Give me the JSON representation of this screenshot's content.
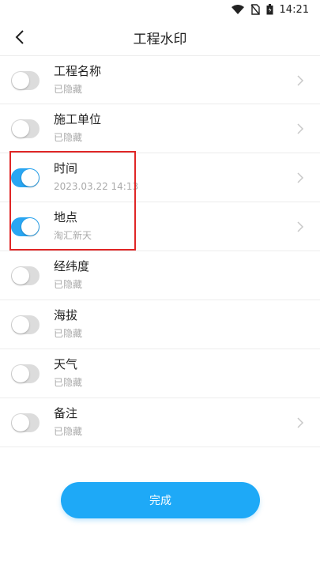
{
  "status_bar": {
    "time": "14:21"
  },
  "header": {
    "title": "工程水印",
    "back_icon": "chevron-left-icon"
  },
  "items": [
    {
      "title": "工程名称",
      "subtitle": "已隐藏",
      "enabled": false,
      "has_arrow": true
    },
    {
      "title": "施工单位",
      "subtitle": "已隐藏",
      "enabled": false,
      "has_arrow": true
    },
    {
      "title": "时间",
      "subtitle": "2023.03.22 14:13",
      "enabled": true,
      "has_arrow": true
    },
    {
      "title": "地点",
      "subtitle": "淘汇新天",
      "enabled": true,
      "has_arrow": true
    },
    {
      "title": "经纬度",
      "subtitle": "已隐藏",
      "enabled": false,
      "has_arrow": false
    },
    {
      "title": "海拔",
      "subtitle": "已隐藏",
      "enabled": false,
      "has_arrow": false
    },
    {
      "title": "天气",
      "subtitle": "已隐藏",
      "enabled": false,
      "has_arrow": false
    },
    {
      "title": "备注",
      "subtitle": "已隐藏",
      "enabled": false,
      "has_arrow": true
    }
  ],
  "done_button": {
    "label": "完成"
  },
  "colors": {
    "accent": "#1ea9f7",
    "toggle_on": "#2aa6f2",
    "toggle_off": "#dcdcdc",
    "highlight": "#e02626"
  }
}
